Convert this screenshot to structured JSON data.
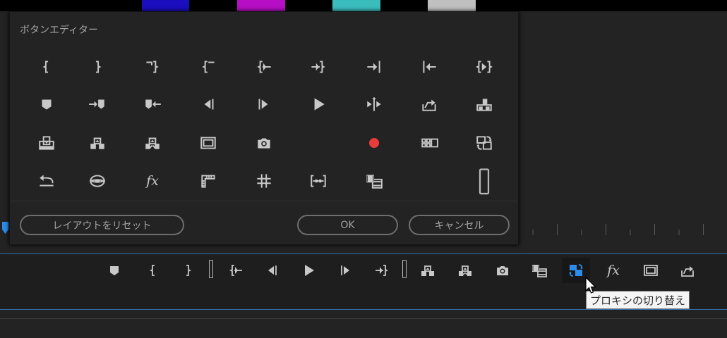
{
  "color_bars": [
    "#000000",
    "#1b0ebf",
    "#000000",
    "#b60ec4",
    "#000000",
    "#3bbdbd",
    "#000000",
    "#c0c0c0",
    "#000000"
  ],
  "dialog": {
    "title": "ボタンエディター",
    "grid": [
      "mark-in-icon",
      "mark-out-icon",
      "clear-in-icon",
      "clear-out-icon",
      "go-to-in-icon",
      "go-to-out-icon",
      "step-to-end-icon",
      "step-to-start-icon",
      "play-in-to-out-icon",
      "add-marker-icon",
      "go-to-next-marker-icon",
      "go-to-previous-marker-icon",
      "step-back-icon",
      "step-forward-icon",
      "play-stop-icon",
      "play-around-icon",
      "export-frame-share-icon",
      "overwrite-icon",
      "insert-icon",
      "lift-icon",
      "extract-icon",
      "safe-margins-icon",
      "camera-icon",
      "empty-slot",
      "record-icon",
      "multicam-icon",
      "toggle-proxies-icon",
      "loop-icon",
      "vr-video-icon",
      "fx-icon",
      "rulers-icon",
      "guides-icon",
      "snap-in-guides-icon",
      "comparison-view-icon",
      "empty-slot",
      "spacer-icon"
    ],
    "fx_label": "fx",
    "reset_label": "レイアウトをリセット",
    "ok_label": "OK",
    "cancel_label": "キャンセル"
  },
  "toolbar": {
    "items": [
      "add-marker-icon",
      "mark-in-icon",
      "mark-out-icon",
      "spacer",
      "go-to-in-icon",
      "step-back-icon",
      "play-stop-icon",
      "step-forward-icon",
      "go-to-out-icon",
      "spacer",
      "lift-icon",
      "extract-icon",
      "camera-icon",
      "comparison-view-icon",
      "toggle-proxies-icon",
      "fx-icon",
      "safe-margins-icon",
      "export-frame-share-icon"
    ],
    "active": "toggle-proxies-icon",
    "fx_label": "fx"
  },
  "tooltip": "プロキシの切り替え",
  "colors": {
    "accent": "#2d8ceb",
    "record": "#e83b3b",
    "icon": "#c8c8c8"
  }
}
